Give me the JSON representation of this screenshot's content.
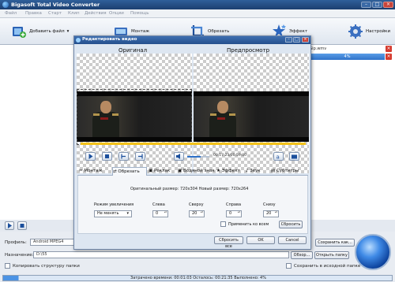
{
  "app": {
    "title": "Bigasoft Total Video Converter",
    "menu": [
      "Файл",
      "Правка",
      "Старт",
      "Клип",
      "Действия",
      "Опции",
      "Помощь"
    ],
    "toolbar": {
      "add_file": "Добавить файл",
      "add_file_arrow": "▾",
      "montage": "Монтаж",
      "crop": "Обрезать",
      "effect": "Эффект",
      "settings": "Настройки"
    },
    "file": {
      "name": "Sip.wmv",
      "progress_label": "4%",
      "progress_value": 0.04
    },
    "bottom": {
      "profile_label": "Профиль:",
      "profile_value": "Android MPEG4",
      "save_as": "Сохранить как...",
      "name_label": "Назначение:",
      "dest_value": "D:\\55",
      "browse": "Обзор...",
      "open_folder": "Открыть папку",
      "copy_structure": "Копировать структуру папки",
      "save_source": "Сохранить в исходной папке"
    },
    "status": "Затрачено времени: 00:01:03 Осталось: 00:21:35 Выполнено: 4%"
  },
  "dialog": {
    "title": "Редактировать видео",
    "original_label": "Оригинал",
    "preview_label": "Предпросмотр",
    "timecode": "00:17:23/00:59:00",
    "tabs": [
      "Монтаж",
      "Обрезать",
      "Реклак",
      "Водяной знак",
      "Эффект",
      "Звук",
      "Субтитры"
    ],
    "active_tab": "Обрезать",
    "size_info": "Оригинальный размер: 720x304  Новый размер: 720x264",
    "crop": {
      "zoom_label": "Режим увеличения",
      "zoom_value": "Не менять",
      "left_label": "Слева",
      "left_value": "0",
      "top_label": "Сверху",
      "top_value": "20",
      "right_label": "Справа",
      "right_value": "0",
      "bottom_label": "Снизу",
      "bottom_value": "20",
      "apply_all": "Применить ко всем",
      "reset": "Сбросить"
    },
    "buttons": {
      "reset_all": "Сбросить все",
      "ok": "OK",
      "cancel": "Cancel"
    }
  }
}
